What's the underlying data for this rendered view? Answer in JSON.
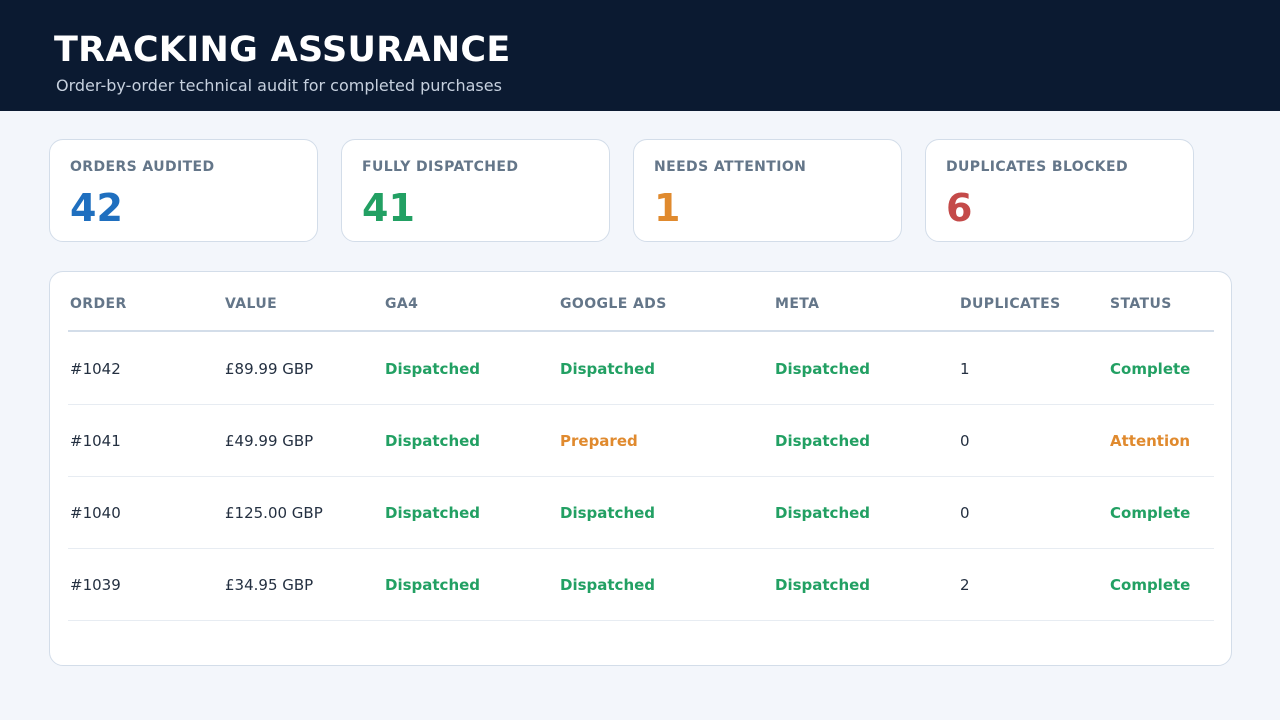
{
  "header": {
    "title": "TRACKING ASSURANCE",
    "subtitle": "Order-by-order technical audit for completed purchases"
  },
  "stats": [
    {
      "label": "ORDERS AUDITED",
      "value": "42",
      "color": "#1f6fbf"
    },
    {
      "label": "FULLY DISPATCHED",
      "value": "41",
      "color": "#22a063"
    },
    {
      "label": "NEEDS ATTENTION",
      "value": "1",
      "color": "#e08a2e"
    },
    {
      "label": "DUPLICATES BLOCKED",
      "value": "6",
      "color": "#c44a49"
    }
  ],
  "colors": {
    "ok": "#22a063",
    "warn": "#e08a2e"
  },
  "table": {
    "columns": [
      "ORDER",
      "VALUE",
      "GA4",
      "GOOGLE ADS",
      "META",
      "DUPLICATES",
      "STATUS"
    ],
    "rows": [
      {
        "order": "#1042",
        "value": "£89.99 GBP",
        "ga4": "Dispatched",
        "google_ads": "Dispatched",
        "meta": "Dispatched",
        "duplicates": "1",
        "status": "Complete"
      },
      {
        "order": "#1041",
        "value": "£49.99 GBP",
        "ga4": "Dispatched",
        "google_ads": "Prepared",
        "meta": "Dispatched",
        "duplicates": "0",
        "status": "Attention"
      },
      {
        "order": "#1040",
        "value": "£125.00 GBP",
        "ga4": "Dispatched",
        "google_ads": "Dispatched",
        "meta": "Dispatched",
        "duplicates": "0",
        "status": "Complete"
      },
      {
        "order": "#1039",
        "value": "£34.95 GBP",
        "ga4": "Dispatched",
        "google_ads": "Dispatched",
        "meta": "Dispatched",
        "duplicates": "2",
        "status": "Complete"
      }
    ]
  }
}
